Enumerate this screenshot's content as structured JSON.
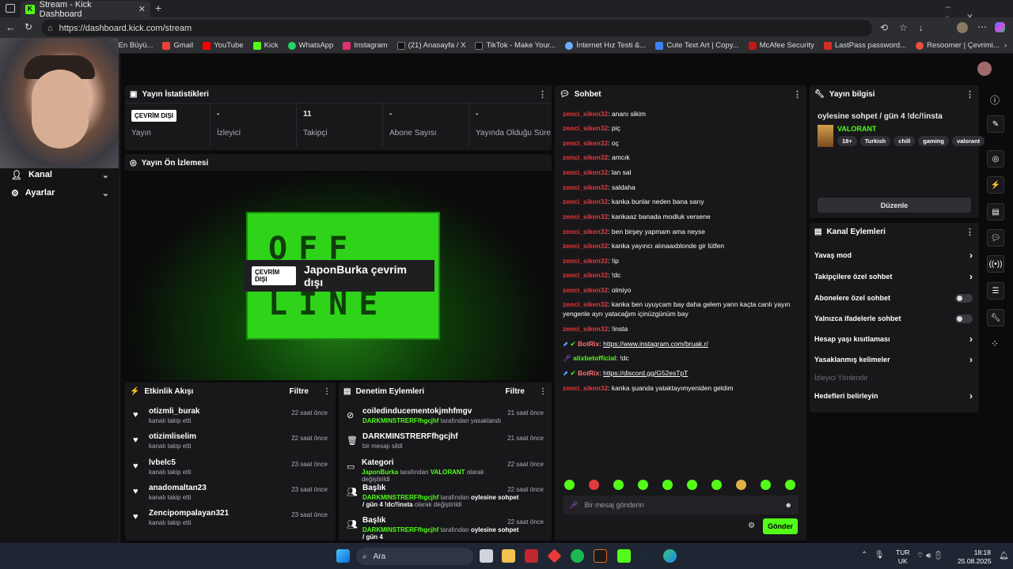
{
  "browser": {
    "tab_title": "Stream - Kick Dashboard",
    "url": "https://dashboard.kick.com/stream",
    "bookmarks": [
      "Türkiye'nin En Büyü...",
      "Gmail",
      "YouTube",
      "Kick",
      "WhatsApp",
      "Instagram",
      "(21) Anasayfa / X",
      "TikTok - Make Your...",
      "İnternet Hız Testi &...",
      "Cute Text Art | Copy...",
      "McAfee Security",
      "LastPass password...",
      "Resoomer | Çevrimi..."
    ]
  },
  "nav": {
    "items": [
      {
        "label": "Kanal"
      },
      {
        "label": "Ayarlar"
      }
    ]
  },
  "stats": {
    "title": "Yayın İstatistikleri",
    "status_badge": "ÇEVRİM DIŞI",
    "cells": [
      {
        "value": "",
        "label": "Yayın"
      },
      {
        "value": "-",
        "label": "İzleyici"
      },
      {
        "value": "11",
        "label": "Takipçi"
      },
      {
        "value": "-",
        "label": "Abone Sayısı"
      },
      {
        "value": "-",
        "label": "Yayında Olduğu Süre"
      }
    ]
  },
  "preview": {
    "title": "Yayın Ön İzlemesi",
    "sign_top": "OFF",
    "sign_bottom": "LINE",
    "badge": "ÇEVRİM DIŞI",
    "text": "JaponBurka çevrim dışı"
  },
  "activity": {
    "title": "Etkinlik Akışı",
    "filter": "Filtre",
    "rows": [
      {
        "name": "otizmli_burak",
        "action": "kanalı takip etti",
        "time": "22 saat önce"
      },
      {
        "name": "otizimliselim",
        "action": "kanalı takip etti",
        "time": "22 saat önce"
      },
      {
        "name": "lvbelc5",
        "action": "kanalı takip etti",
        "time": "23 saat önce"
      },
      {
        "name": "anadomaltan23",
        "action": "kanalı takip etti",
        "time": "23 saat önce"
      },
      {
        "name": "Zencipompalayan321",
        "action": "kanalı takip etti",
        "time": "23 saat önce"
      }
    ]
  },
  "moderation": {
    "title": "Denetim Eylemleri",
    "filter": "Filtre",
    "rows": [
      {
        "title": "coiledinducementokjmhfmgv",
        "actor": "DARKMINSTRERFfhgcjhf",
        "rest": "tarafından yasaklandı",
        "time": "21 saat önce"
      },
      {
        "title": "DARKMINSTRERFfhgcjhf",
        "actor": "",
        "rest": "bir mesajı sildi",
        "time": "21 saat önce"
      },
      {
        "title": "Kategori",
        "actor": "JaponBurka",
        "rest": "tarafından",
        "extra": "VALORANT",
        "rest2": "olarak değiştirildi",
        "time": "22 saat önce"
      },
      {
        "title": "Başlık",
        "actor": "DARKMINSTRERFfhgcjhf",
        "rest": "tarafından",
        "extra": "oylesine sohpet / gün 4 !dc/!insta",
        "rest2": "olarak değiştirildi",
        "time": "22 saat önce"
      },
      {
        "title": "Başlık",
        "actor": "DARKMINSTRERFfhgcjhf",
        "rest": "tarafından",
        "extra": "oylesine sohpet / gün 4",
        "rest2": "",
        "time": "22 saat önce"
      }
    ]
  },
  "chat": {
    "title": "Sohbet",
    "messages": [
      {
        "user": "zenci_siken32",
        "text": "ananı sikim"
      },
      {
        "user": "zenci_siken32",
        "text": "piç"
      },
      {
        "user": "zenci_siken32",
        "text": "oç"
      },
      {
        "user": "zenci_siken32",
        "text": "amcık"
      },
      {
        "user": "zenci_siken32",
        "text": "lan sal"
      },
      {
        "user": "zenci_siken32",
        "text": "saldaha"
      },
      {
        "user": "zenci_siken32",
        "text": "kanka bunlar neden bana sarıy"
      },
      {
        "user": "zenci_siken32",
        "text": "kankaaz banada modluk versene"
      },
      {
        "user": "zenci_siken32",
        "text": "ben birşey yapmam ama neyse"
      },
      {
        "user": "zenci_siken32",
        "text": "kanka yayıncı alınaaxblonde gir lütfen"
      },
      {
        "user": "zenci_siken32",
        "text": "!ip"
      },
      {
        "user": "zenci_siken32",
        "text": "!dc"
      },
      {
        "user": "zenci_siken32",
        "text": "olmiyo"
      },
      {
        "user": "zenci_siken32",
        "text": "kanka ben uyuycam bay daha gelem yarın kaçta canlı yayın yengenle ayrı yatacağım içinüzgünüm bay"
      },
      {
        "user": "zenci_siken32",
        "text": "!insta"
      },
      {
        "user": "BotRix",
        "text": "https://www.instagram.com/bruak.r/"
      },
      {
        "user": "alixbetofficial",
        "text": "!dc"
      },
      {
        "user": "BotRix",
        "text": "https://discord.gg/G52esTpT"
      },
      {
        "user": "zenci_siken32",
        "text": "kanka şuanda yataktayımyeniden geldim"
      }
    ],
    "input_placeholder": "Bir mesaj gönderin",
    "send": "Gönder"
  },
  "stream_info": {
    "title_label": "Yayın bilgisi",
    "stream_title": "oylesine sohpet / gün 4 !dc/!insta",
    "category": "VALORANT",
    "tags": [
      "18+",
      "Turkish",
      "chill",
      "gaming",
      "valorant"
    ],
    "edit": "Düzenle"
  },
  "channel_actions": {
    "title": "Kanal Eylemleri",
    "items": [
      "Yavaş mod",
      "Takipçilere özel sohbet",
      "Abonelere özel sohbet",
      "Yalnızca ifadelerle sohbet",
      "Hesap yaşı kısıtlaması",
      "Yasaklanmış kelimeler"
    ],
    "viewer_section": "İzleyici Yönlendir",
    "target": "Hedefleri belirleyin"
  },
  "taskbar": {
    "search": "Ara",
    "lang1": "TUR",
    "lang2": "UK",
    "time": "18:18",
    "date": "25.08.2025"
  },
  "colors": {
    "accent": "#53fc18",
    "chat_user": "#e8393b",
    "bg": "#0b0b0c",
    "panel": "#18181b"
  }
}
